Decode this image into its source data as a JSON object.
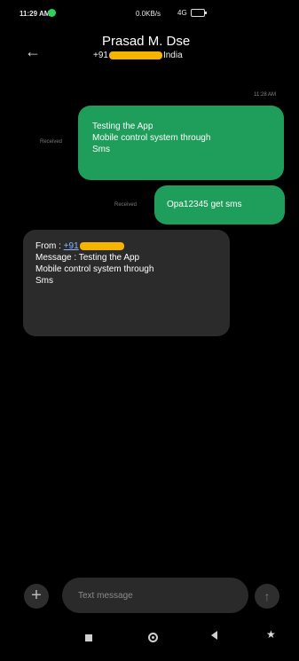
{
  "status_bar": {
    "time": "11:29 AM",
    "network_speed": "0.0KB/s",
    "signal_text": "4G"
  },
  "header": {
    "back_icon": "←",
    "contact_name": "Prasad M. Dse",
    "number_prefix": "+91",
    "number_suffix": "India"
  },
  "thread": {
    "time": "11:28 AM",
    "messages": [
      {
        "label": "Received",
        "lines": [
          "Testing the App",
          "Mobile control system through",
          "Sms"
        ]
      },
      {
        "label": "Received",
        "text": "Opa12345 get sms"
      }
    ],
    "reply": {
      "from_label": "From :",
      "from_value": "+91",
      "message_lines": [
        "Message : Testing the App",
        "Mobile control system through",
        "Sms"
      ]
    }
  },
  "composer": {
    "plus_icon": "+",
    "placeholder": "Text message",
    "send_icon": "↑"
  },
  "nav": {
    "assist_icon": "★"
  },
  "colors": {
    "bubble_green": "#1e9e5a",
    "bubble_dark": "#2b2b2b",
    "highlight": "#f4b400"
  }
}
